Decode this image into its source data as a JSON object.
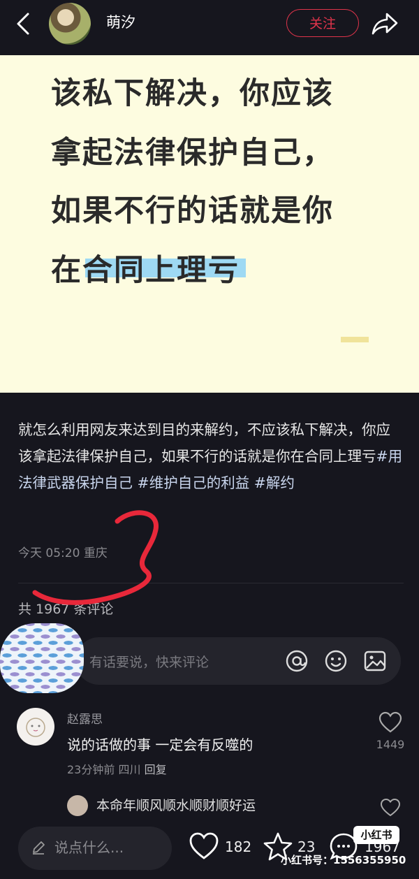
{
  "header": {
    "author": "萌汐",
    "follow_label": "关注"
  },
  "note_image": {
    "lines": [
      "该私下解决，你应该",
      "拿起法律保护自己，",
      "如果不行的话就是你",
      "在合同上理亏"
    ]
  },
  "body": {
    "text_1": "就怎么利用网友来达到目的来解约，不应该私下解决，你应该拿起法律保护自己，如果不行的话就是你在合同上理亏",
    "tags": [
      "#用法律武器保护自己",
      "#维护自己的利益",
      "#解约"
    ],
    "time": "今天 05:20",
    "location": "重庆",
    "comment_count": "共 1967 条评论"
  },
  "comment_input": {
    "placeholder": "有话要说，快来评论"
  },
  "comment": {
    "name": "赵露思",
    "text": "说的话做的事 一定会有反噬的",
    "time": "23分钟前",
    "location": "四川",
    "reply": "回复",
    "likes": "1449"
  },
  "reply_preview": {
    "text": "本命年顺风顺水顺财顺好运"
  },
  "bottom": {
    "say_placeholder": "说点什么...",
    "likes": "182",
    "stars": "23",
    "comments": "1967"
  },
  "watermark": {
    "badge": "小红书",
    "id": "小红书号：1556355950"
  }
}
